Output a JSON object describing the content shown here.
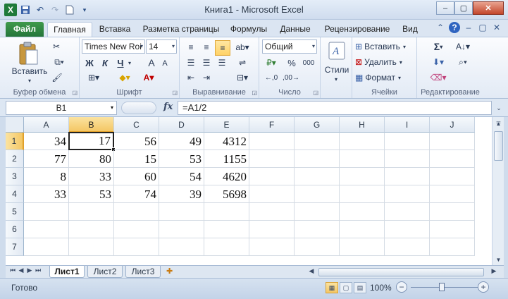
{
  "window": {
    "title": "Книга1  -  Microsoft Excel",
    "qat_icons": [
      "excel-logo-icon",
      "save-icon",
      "undo-icon",
      "redo-icon",
      "new-document-icon",
      "customize-qat-icon"
    ],
    "controls": {
      "minimize": "–",
      "maximize": "▢",
      "close": "✕"
    }
  },
  "tabs": [
    {
      "label": "Файл",
      "type": "file"
    },
    {
      "label": "Главная",
      "type": "active"
    },
    {
      "label": "Вставка"
    },
    {
      "label": "Разметка страницы"
    },
    {
      "label": "Формулы"
    },
    {
      "label": "Данные"
    },
    {
      "label": "Рецензирование"
    },
    {
      "label": "Вид"
    }
  ],
  "ribbon": {
    "clipboard": {
      "label": "Буфер обмена",
      "paste": "Вставить"
    },
    "font": {
      "label": "Шрифт",
      "name": "Times New Roi",
      "size": "14",
      "bold": "Ж",
      "italic": "К",
      "underline": "Ч",
      "grow": "A",
      "shrink": "A",
      "font_color": "A"
    },
    "alignment": {
      "label": "Выравнивание"
    },
    "number": {
      "label": "Число",
      "format": "Общий",
      "percent": "%",
      "thousands": "000"
    },
    "styles": {
      "label": "Стили"
    },
    "cells": {
      "label": "Ячейки",
      "insert": "Вставить",
      "delete": "Удалить",
      "format": "Формат"
    },
    "editing": {
      "label": "Редактирование",
      "sum": "Σ"
    }
  },
  "formula_bar": {
    "name_box": "B1",
    "fx": "fx",
    "formula": "=A1/2"
  },
  "sheet": {
    "columns": [
      "A",
      "B",
      "C",
      "D",
      "E",
      "F",
      "G",
      "H",
      "I",
      "J"
    ],
    "active_column": "B",
    "rows": [
      "1",
      "2",
      "3",
      "4",
      "5",
      "6",
      "7"
    ],
    "active_row": "1",
    "cells": [
      [
        "34",
        "17",
        "56",
        "49",
        "4312"
      ],
      [
        "77",
        "80",
        "15",
        "53",
        "1155"
      ],
      [
        "8",
        "33",
        "60",
        "54",
        "4620"
      ],
      [
        "33",
        "53",
        "74",
        "39",
        "5698"
      ]
    ],
    "selected_cell": "B1"
  },
  "sheet_tabs": [
    {
      "label": "Лист1",
      "active": true
    },
    {
      "label": "Лист2"
    },
    {
      "label": "Лист3"
    }
  ],
  "status": {
    "ready": "Готово",
    "zoom": "100%",
    "zoom_out": "−",
    "zoom_in": "+"
  }
}
